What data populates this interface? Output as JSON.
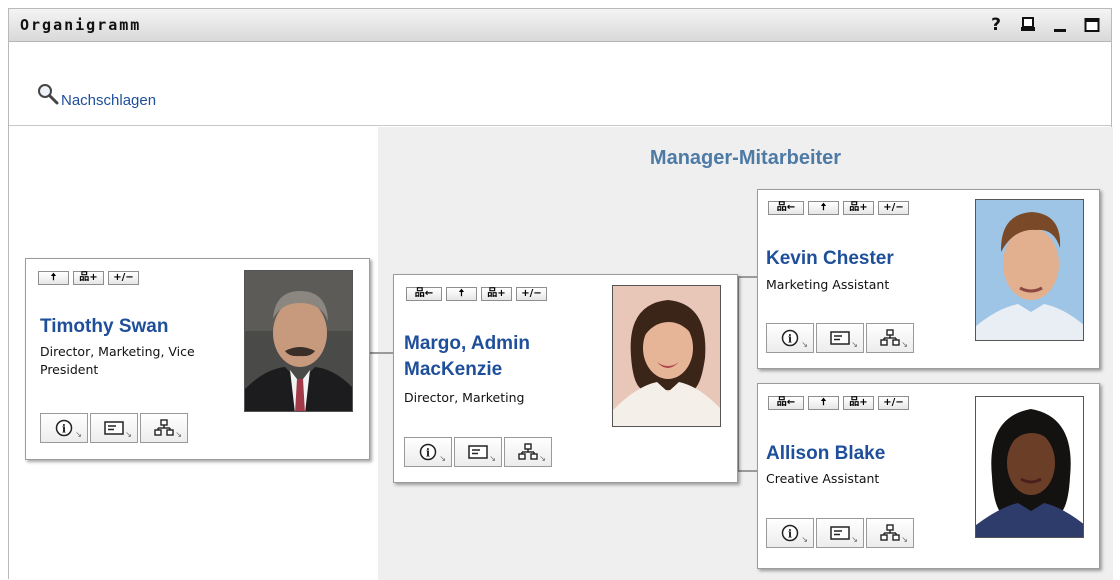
{
  "window": {
    "title": "Organigramm",
    "icons": [
      "help-icon",
      "print-icon",
      "minimize-icon",
      "maximize-icon"
    ],
    "help_glyph": "?"
  },
  "toolbar": {
    "search_label": "Nachschlagen"
  },
  "panel": {
    "title": "Manager-Mitarbeiter"
  },
  "mini_buttons": {
    "up": "🠅",
    "expand": "品+",
    "toggle": "+/−",
    "back": "品←"
  },
  "people": {
    "timothy": {
      "name": "Timothy Swan",
      "role_line1": "Director, Marketing, Vice",
      "role_line2": "President"
    },
    "margo": {
      "name_line1": "Margo, Admin",
      "name_line2": "MacKenzie",
      "role": "Director, Marketing"
    },
    "kevin": {
      "name": "Kevin Chester",
      "role": "Marketing Assistant"
    },
    "allison": {
      "name": "Allison Blake",
      "role": "Creative Assistant"
    }
  },
  "colors": {
    "link": "#1f4f9a",
    "panel_title": "#4e7aa6",
    "panel_bg": "#efefef"
  }
}
